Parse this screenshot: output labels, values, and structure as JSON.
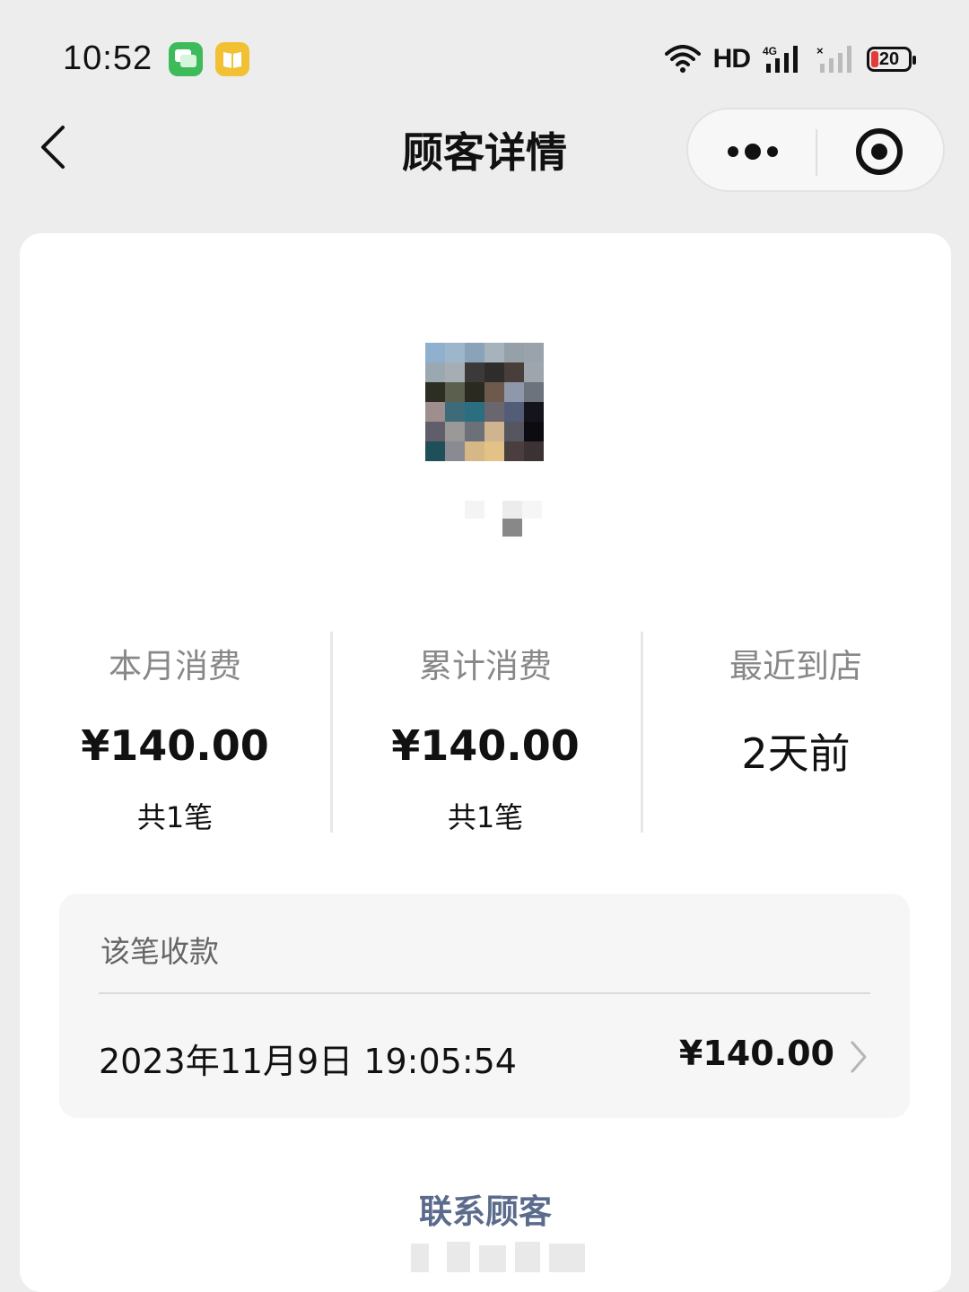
{
  "status_bar": {
    "time": "10:52",
    "network_label": "HD",
    "cell_label": "4G",
    "battery_level": "20"
  },
  "nav": {
    "title": "顾客详情"
  },
  "stats": [
    {
      "label": "本月消费",
      "value": "¥140.00",
      "count": "共1笔"
    },
    {
      "label": "累计消费",
      "value": "¥140.00",
      "count": "共1笔"
    },
    {
      "label": "最近到店",
      "value": "2天前"
    }
  ],
  "payment": {
    "section_label": "该笔收款",
    "datetime": "2023年11月9日 19:05:54",
    "amount": "¥140.00"
  },
  "contact_button": "联系顾客",
  "colors": {
    "background": "#ededed",
    "card": "#ffffff",
    "link": "#5b6b8c",
    "battery_low": "#e23b3b"
  }
}
